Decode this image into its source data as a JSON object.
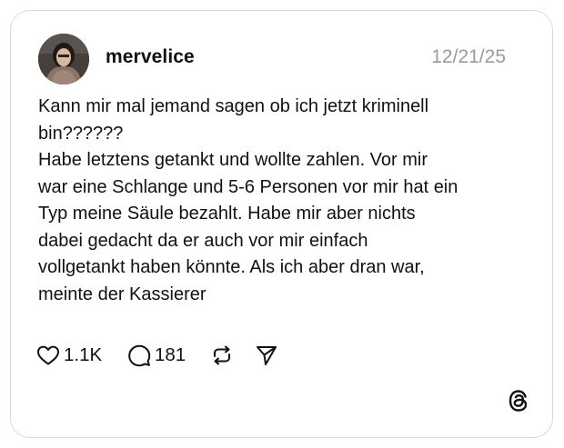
{
  "post": {
    "username": "mervelice",
    "timestamp": "12/21/25",
    "text_lines": [
      "Kann mir mal jemand sagen ob ich jetzt kriminell",
      "bin??????",
      "Habe letztens getankt und wollte zahlen. Vor mir",
      "war eine Schlange und 5-6 Personen vor mir hat ein",
      "Typ meine Säule bezahlt. Habe mir aber nichts",
      "dabei gedacht da er auch vor mir einfach",
      "vollgetankt haben könnte. Als ich aber dran war,",
      "meinte der Kassierer"
    ]
  },
  "actions": {
    "likes": "1.1K",
    "comments": "181"
  },
  "icons": {
    "like": "heart-icon",
    "comment": "speech-bubble-icon",
    "repost": "repost-icon",
    "share": "send-icon",
    "brand": "threads-logo-icon"
  }
}
